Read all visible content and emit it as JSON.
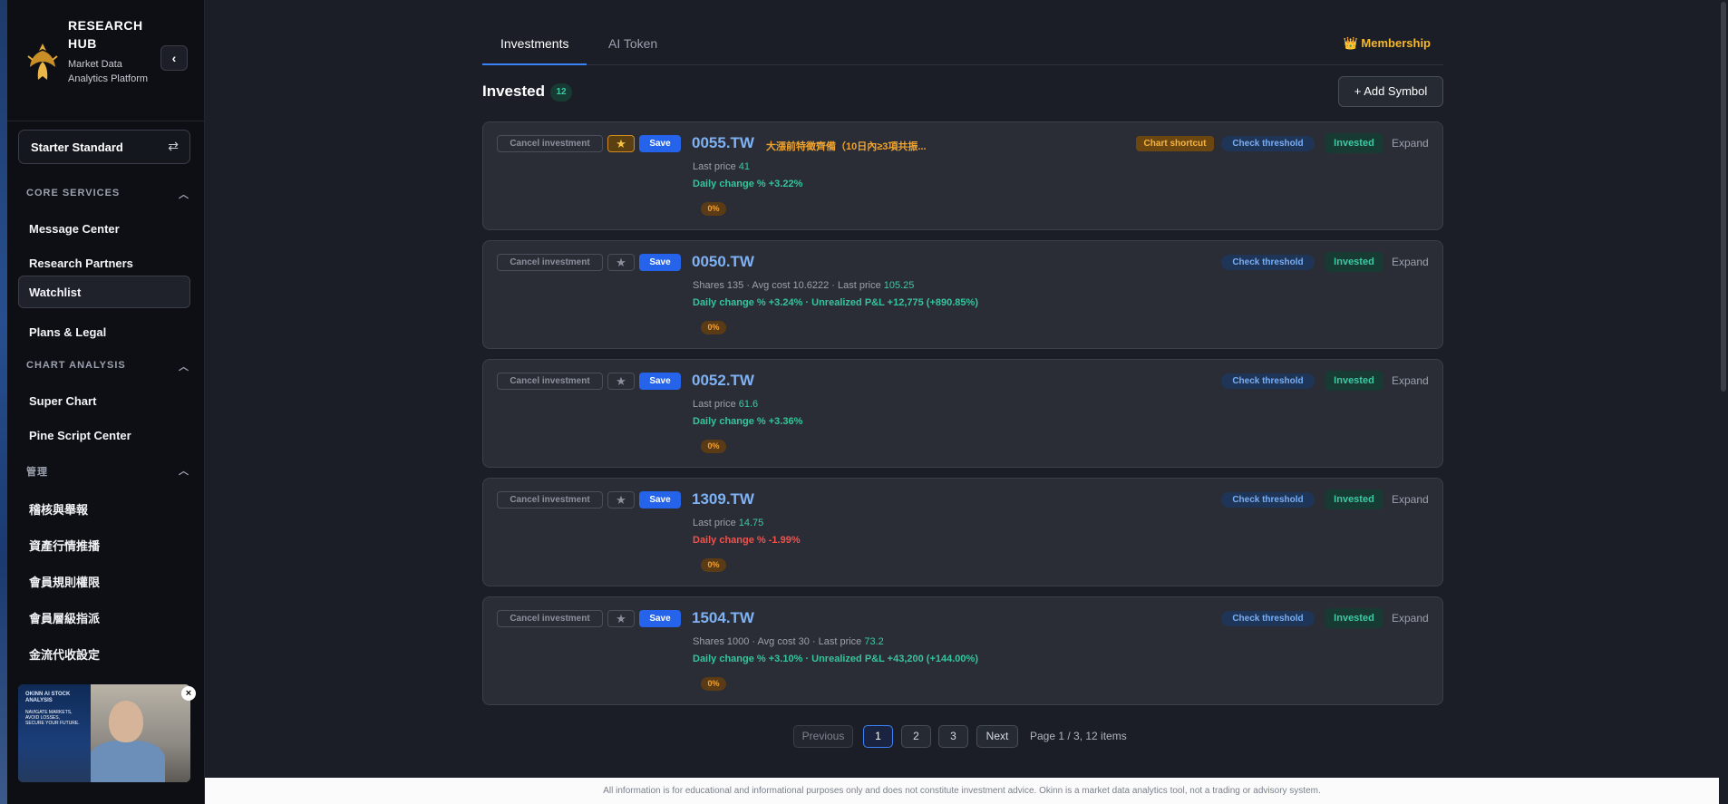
{
  "brand": {
    "title": "RESEARCH HUB",
    "subtitle": "Market Data Analytics Platform"
  },
  "sidebar": {
    "plan_label": "Starter Standard",
    "sections": [
      {
        "title": "CORE SERVICES",
        "items": [
          "Message Center",
          "Research Partners",
          "Watchlist",
          "Plans & Legal"
        ]
      },
      {
        "title": "CHART ANALYSIS",
        "items": [
          "Super Chart",
          "Pine Script Center"
        ]
      },
      {
        "title": "管理",
        "items": [
          "稽核與舉報",
          "資產行情推播",
          "會員規則權限",
          "會員層級指派",
          "金流代收設定"
        ]
      }
    ],
    "active_item": "Watchlist",
    "video": {
      "brand": "OKINN AI STOCK ANALYSIS",
      "tagline": "NAVIGATE MARKETS, AVOID LOSSES, SECURE YOUR FUTURE."
    }
  },
  "tabs": [
    {
      "label": "Investments",
      "active": true
    },
    {
      "label": "AI Token",
      "active": false
    }
  ],
  "membership_label": "Membership",
  "list": {
    "heading": "Invested",
    "count": "12",
    "add_label": "+ Add Symbol"
  },
  "cards": [
    {
      "cancel": "Cancel investment",
      "starred": true,
      "save": "Save",
      "symbol": "0055.TW",
      "alert": "大漲前特徵齊備（10日內≥3項共振...",
      "info_prefix": "Last price ",
      "last_price": "41",
      "change": "Daily change % +3.22%",
      "change_dir": "up",
      "pct": "0%",
      "chart_shortcut": "Chart shortcut",
      "check": "Check threshold",
      "status": "Invested",
      "expand": "Expand"
    },
    {
      "cancel": "Cancel investment",
      "starred": false,
      "save": "Save",
      "symbol": "0050.TW",
      "alert": "",
      "info_prefix": "Shares 135 · Avg cost 10.6222 · Last price ",
      "last_price": "105.25",
      "change": "Daily change % +3.24% · Unrealized P&L +12,775  (+890.85%)",
      "change_dir": "up",
      "pct": "0%",
      "chart_shortcut": "",
      "check": "Check threshold",
      "status": "Invested",
      "expand": "Expand"
    },
    {
      "cancel": "Cancel investment",
      "starred": false,
      "save": "Save",
      "symbol": "0052.TW",
      "alert": "",
      "info_prefix": "Last price ",
      "last_price": "61.6",
      "change": "Daily change % +3.36%",
      "change_dir": "up",
      "pct": "0%",
      "chart_shortcut": "",
      "check": "Check threshold",
      "status": "Invested",
      "expand": "Expand"
    },
    {
      "cancel": "Cancel investment",
      "starred": false,
      "save": "Save",
      "symbol": "1309.TW",
      "alert": "",
      "info_prefix": "Last price ",
      "last_price": "14.75",
      "change": "Daily change % -1.99%",
      "change_dir": "down",
      "pct": "0%",
      "chart_shortcut": "",
      "check": "Check threshold",
      "status": "Invested",
      "expand": "Expand"
    },
    {
      "cancel": "Cancel investment",
      "starred": false,
      "save": "Save",
      "symbol": "1504.TW",
      "alert": "",
      "info_prefix": "Shares 1000 · Avg cost 30 · Last price ",
      "last_price": "73.2",
      "change": "Daily change % +3.10% · Unrealized P&L +43,200  (+144.00%)",
      "change_dir": "up",
      "pct": "0%",
      "chart_shortcut": "",
      "check": "Check threshold",
      "status": "Invested",
      "expand": "Expand"
    }
  ],
  "pagination": {
    "prev": "Previous",
    "pages": [
      "1",
      "2",
      "3"
    ],
    "current": "1",
    "next": "Next",
    "info": "Page 1 / 3, 12 items"
  },
  "footer": "All information is for educational and informational purposes only and does not constitute investment advice. Okinn is a market data analytics tool, not a trading or advisory system."
}
